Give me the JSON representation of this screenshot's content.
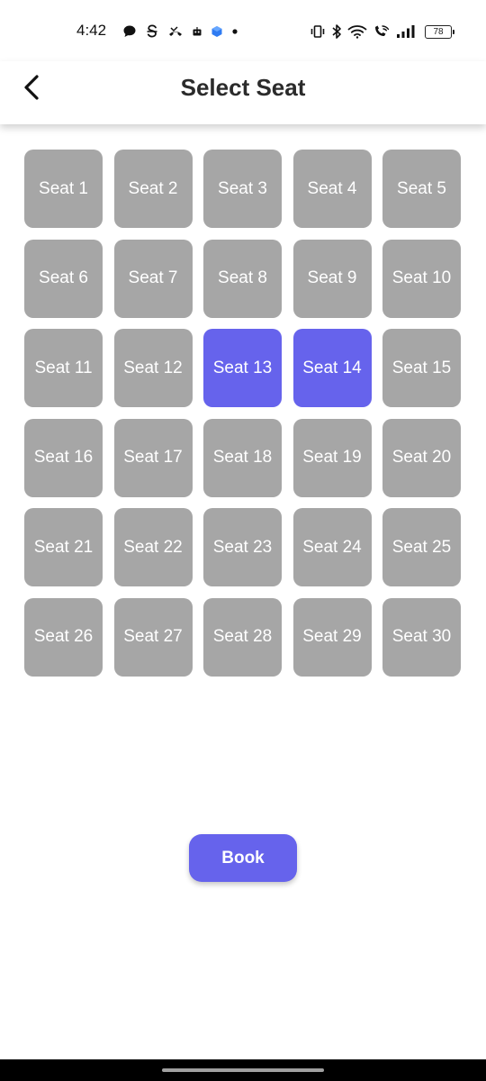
{
  "status_bar": {
    "time": "4:42",
    "battery": "78",
    "left_icons": [
      "chat-bubble-icon",
      "s-circle-icon",
      "call-missed-icon",
      "robot-icon",
      "app-cube-icon",
      "dot-icon"
    ],
    "right_icons": [
      "vibrate-icon",
      "bluetooth-icon",
      "wifi-icon",
      "wifi-call-icon",
      "signal-icon"
    ]
  },
  "header": {
    "title": "Select Seat",
    "back_icon": "chevron-left-icon"
  },
  "colors": {
    "seat_default": "#a6a6a6",
    "seat_selected": "#6663ec",
    "accent": "#6663ec"
  },
  "seats": [
    {
      "label": "Seat 1",
      "selected": false
    },
    {
      "label": "Seat 2",
      "selected": false
    },
    {
      "label": "Seat 3",
      "selected": false
    },
    {
      "label": "Seat 4",
      "selected": false
    },
    {
      "label": "Seat 5",
      "selected": false
    },
    {
      "label": "Seat 6",
      "selected": false
    },
    {
      "label": "Seat 7",
      "selected": false
    },
    {
      "label": "Seat 8",
      "selected": false
    },
    {
      "label": "Seat 9",
      "selected": false
    },
    {
      "label": "Seat 10",
      "selected": false
    },
    {
      "label": "Seat 11",
      "selected": false
    },
    {
      "label": "Seat 12",
      "selected": false
    },
    {
      "label": "Seat 13",
      "selected": true
    },
    {
      "label": "Seat 14",
      "selected": true
    },
    {
      "label": "Seat 15",
      "selected": false
    },
    {
      "label": "Seat 16",
      "selected": false
    },
    {
      "label": "Seat 17",
      "selected": false
    },
    {
      "label": "Seat 18",
      "selected": false
    },
    {
      "label": "Seat 19",
      "selected": false
    },
    {
      "label": "Seat 20",
      "selected": false
    },
    {
      "label": "Seat 21",
      "selected": false
    },
    {
      "label": "Seat 22",
      "selected": false
    },
    {
      "label": "Seat 23",
      "selected": false
    },
    {
      "label": "Seat 24",
      "selected": false
    },
    {
      "label": "Seat 25",
      "selected": false
    },
    {
      "label": "Seat 26",
      "selected": false
    },
    {
      "label": "Seat 27",
      "selected": false
    },
    {
      "label": "Seat 28",
      "selected": false
    },
    {
      "label": "Seat 29",
      "selected": false
    },
    {
      "label": "Seat 30",
      "selected": false
    }
  ],
  "actions": {
    "book_label": "Book"
  }
}
